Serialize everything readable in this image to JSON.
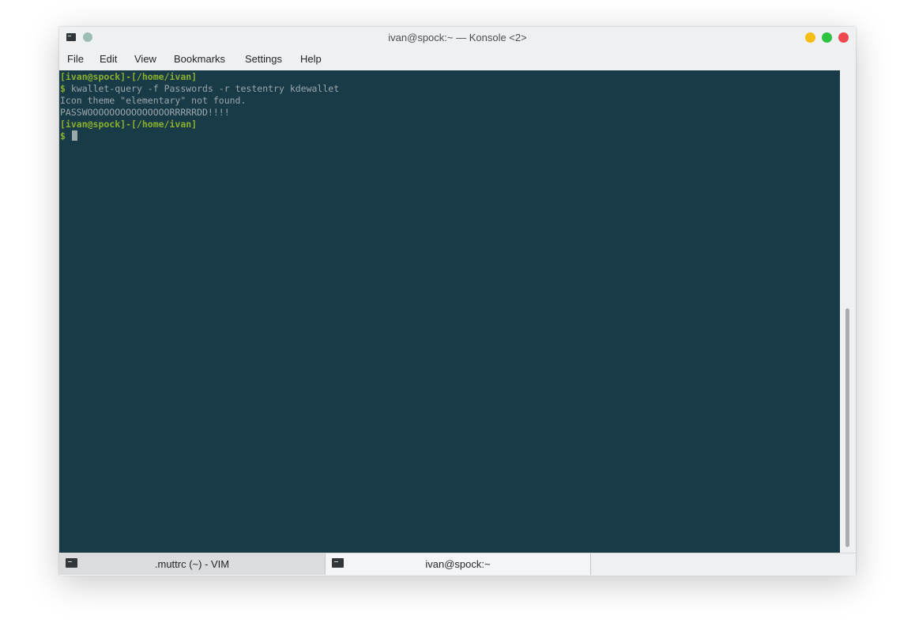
{
  "window": {
    "title": "ivan@spock:~ — Konsole <2>",
    "app_icon": "terminal-icon",
    "controls": [
      "minimize",
      "maximize",
      "close"
    ],
    "colors": {
      "minimize": "#f6bd17",
      "maximize": "#2dc23f",
      "close": "#f0484f"
    }
  },
  "menubar": {
    "items": [
      "File",
      "Edit",
      "View",
      "Bookmarks",
      "Settings",
      "Help"
    ]
  },
  "terminal": {
    "background": "#183b47",
    "prompt_color": "#8ab02e",
    "lines": [
      {
        "type": "prompt",
        "text": "[ivan@spock]-[/home/ivan]"
      },
      {
        "type": "command",
        "symbol": "$",
        "text": "kwallet-query -f Passwords -r testentry kdewallet"
      },
      {
        "type": "output",
        "text": "Icon theme \"elementary\" not found."
      },
      {
        "type": "output",
        "text": "PASSWOOOOOOOOOOOOOOORRRRRDD!!!!"
      },
      {
        "type": "prompt",
        "text": "[ivan@spock]-[/home/ivan]"
      },
      {
        "type": "command",
        "symbol": "$",
        "text": ""
      }
    ]
  },
  "tabs": [
    {
      "label": ".muttrc (~) - VIM",
      "icon": "terminal-icon",
      "active": false
    },
    {
      "label": "ivan@spock:~",
      "icon": "terminal-icon",
      "active": true
    }
  ]
}
